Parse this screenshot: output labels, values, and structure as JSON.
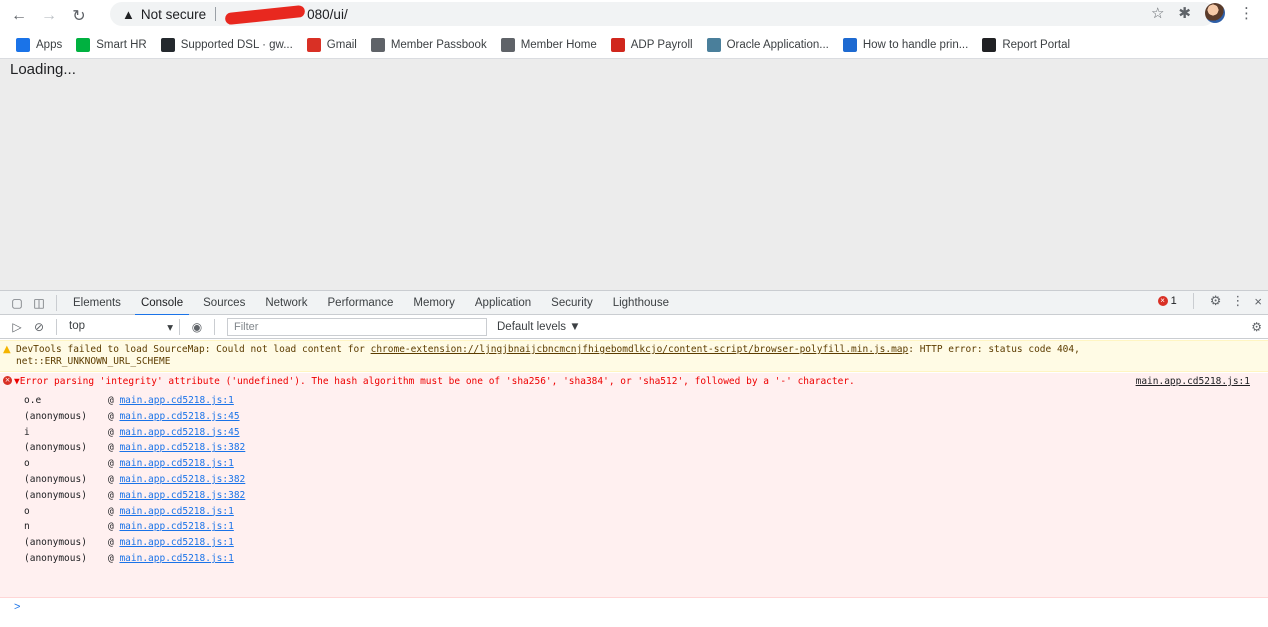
{
  "browser": {
    "security_label": "Not secure",
    "url_visible": "080/ui/",
    "bookmarks": [
      {
        "label": "Apps",
        "icon": "apps-grid-icon",
        "color": "#1a73e8"
      },
      {
        "label": "Smart HR",
        "icon": "sage-icon",
        "color": "#00b140"
      },
      {
        "label": "Supported DSL · gw...",
        "icon": "github-icon",
        "color": "#24292e"
      },
      {
        "label": "Gmail",
        "icon": "gmail-icon",
        "color": "#d93025"
      },
      {
        "label": "Member Passbook",
        "icon": "globe-icon",
        "color": "#5f6368"
      },
      {
        "label": "Member Home",
        "icon": "globe-icon",
        "color": "#5f6368"
      },
      {
        "label": "ADP Payroll",
        "icon": "adp-icon",
        "color": "#d0271d"
      },
      {
        "label": "Oracle Application...",
        "icon": "oracle-icon",
        "color": "#4a7f9b"
      },
      {
        "label": "How to handle prin...",
        "icon": "nt-icon",
        "color": "#1e6ad1"
      },
      {
        "label": "Report Portal",
        "icon": "report-portal-icon",
        "color": "#202124"
      }
    ]
  },
  "page": {
    "loading_text": "Loading..."
  },
  "devtools": {
    "tabs": [
      "Elements",
      "Console",
      "Sources",
      "Network",
      "Performance",
      "Memory",
      "Application",
      "Security",
      "Lighthouse"
    ],
    "active_tab": "Console",
    "error_count": "1",
    "context": "top",
    "filter_placeholder": "Filter",
    "levels": "Default levels ▼",
    "warning": {
      "prefix": "DevTools failed to load SourceMap: Could not load content for ",
      "link": "chrome-extension://ljngjbnaijcbncmcnjfhigebomdlkcjo/content-script/browser-polyfill.min.js.map",
      "suffix": ": HTTP error: status code 404,",
      "line2": "net::ERR_UNKNOWN_URL_SCHEME"
    },
    "error": {
      "message": "▼Error parsing 'integrity' attribute ('undefined'). The hash algorithm must be one of 'sha256', 'sha384', or 'sha512', followed by a '-' character.",
      "source": "main.app.cd5218.js:1",
      "stack": [
        {
          "fn": "o.e",
          "loc": "main.app.cd5218.js:1"
        },
        {
          "fn": "(anonymous)",
          "loc": "main.app.cd5218.js:45"
        },
        {
          "fn": "i",
          "loc": "main.app.cd5218.js:45"
        },
        {
          "fn": "(anonymous)",
          "loc": "main.app.cd5218.js:382"
        },
        {
          "fn": "o",
          "loc": "main.app.cd5218.js:1"
        },
        {
          "fn": "(anonymous)",
          "loc": "main.app.cd5218.js:382"
        },
        {
          "fn": "(anonymous)",
          "loc": "main.app.cd5218.js:382"
        },
        {
          "fn": "o",
          "loc": "main.app.cd5218.js:1"
        },
        {
          "fn": "n",
          "loc": "main.app.cd5218.js:1"
        },
        {
          "fn": "(anonymous)",
          "loc": "main.app.cd5218.js:1"
        },
        {
          "fn": "(anonymous)",
          "loc": "main.app.cd5218.js:1"
        }
      ]
    },
    "prompt": ">"
  }
}
